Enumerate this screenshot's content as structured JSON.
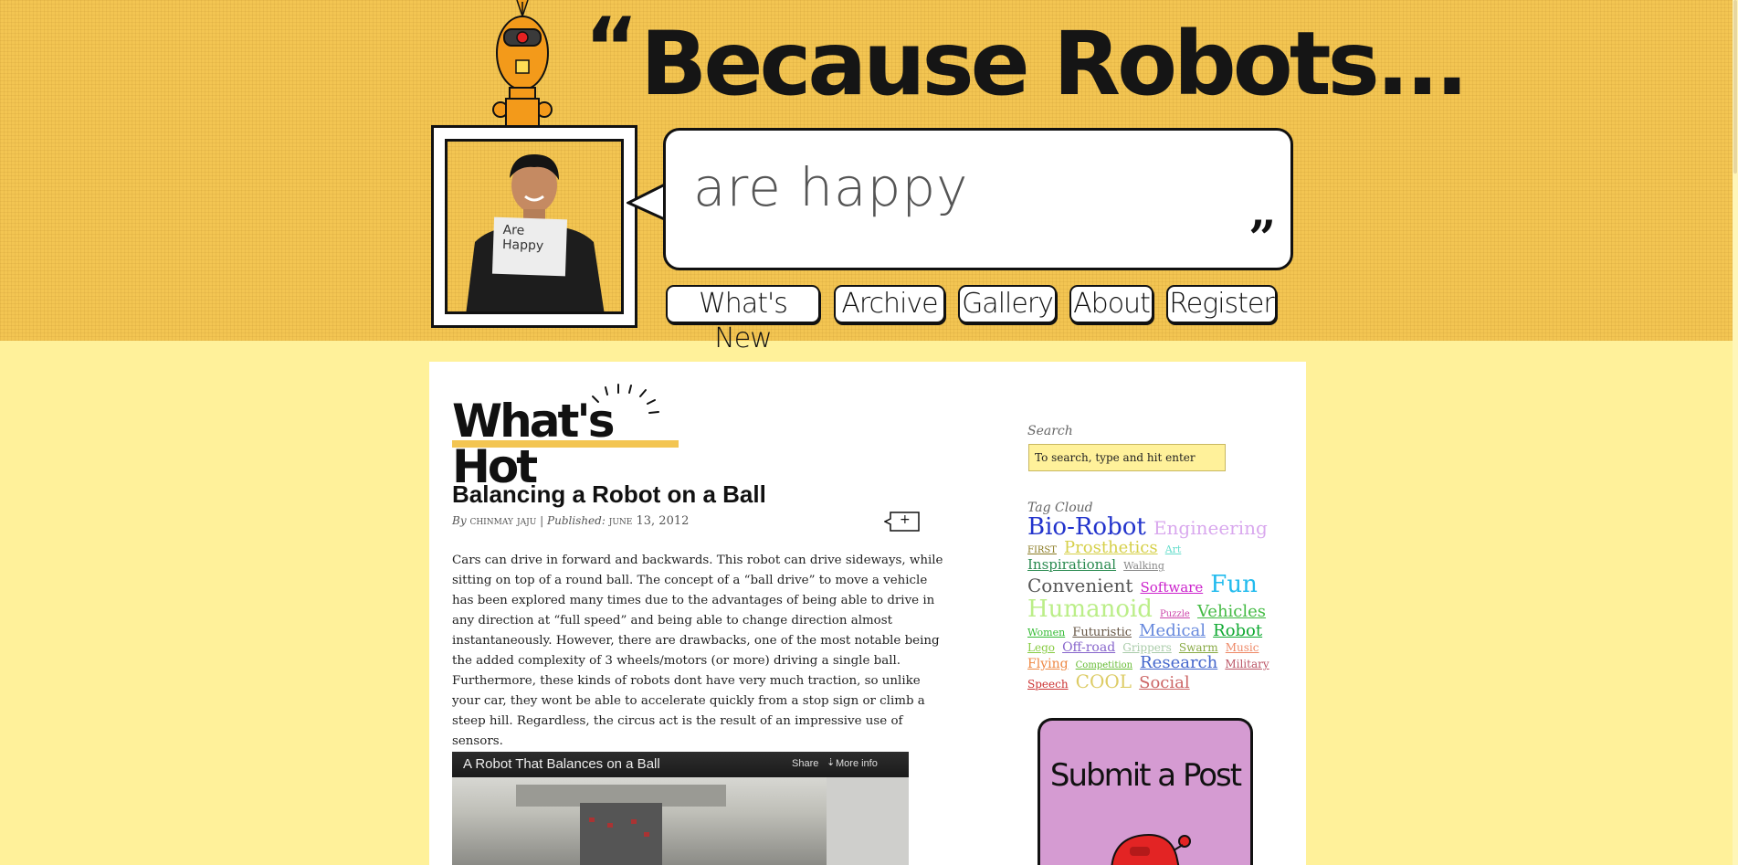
{
  "header": {
    "title": "Because Robots...",
    "open_quote": "“",
    "tagline": "are happy",
    "close_quote": "”",
    "sign_text": "Are Happy"
  },
  "nav": {
    "items": [
      {
        "label": "What's New"
      },
      {
        "label": "Archive"
      },
      {
        "label": "Gallery"
      },
      {
        "label": "About"
      },
      {
        "label": "Register"
      }
    ]
  },
  "main": {
    "section_title": "What's Hot",
    "post": {
      "title": "Balancing a Robot on a Ball",
      "by": "By",
      "author": "CHINMAY JAJU",
      "published_label": "| Published:",
      "date": "JUNE 13, 2012",
      "share_icon_label": "+",
      "body": "Cars can drive in forward and backwards. This robot can drive sideways, while sitting on top of a round ball. The concept of a “ball drive” to move a vehicle has been explored many times due to the advantages of being able to drive in any direction at “full speed” and being able to change direction almost instantaneously. However, there are drawbacks, one of the most notable being the added complexity of 3 wheels/motors (or more) driving a single ball. Furthermore, these kinds of robots dont have very much traction, so unlike your car, they wont be able to accelerate quickly from a stop sign or climb a steep hill. Regardless, the circus act is the result of an impressive use of sensors."
    },
    "video": {
      "title": "A Robot That Balances on a Ball",
      "share": "Share",
      "more_info": "More info"
    }
  },
  "sidebar": {
    "search_label": "Search",
    "search_placeholder": "To search, type and hit enter",
    "tag_cloud_label": "Tag Cloud",
    "tags": [
      {
        "label": "Bio-Robot",
        "color": "#2233cc",
        "size": 26
      },
      {
        "label": "Engineering",
        "color": "#d9a8ee",
        "size": 20
      },
      {
        "label": "FIRST",
        "color": "#8a7a22",
        "size": 10
      },
      {
        "label": "Prosthetics",
        "color": "#d6d04a",
        "size": 18
      },
      {
        "label": "Art",
        "color": "#66ddcc",
        "size": 11
      },
      {
        "label": "Inspirational",
        "color": "#2a8a50",
        "size": 15
      },
      {
        "label": "Walking",
        "color": "#888888",
        "size": 11
      },
      {
        "label": "Convenient",
        "color": "#555555",
        "size": 20
      },
      {
        "label": "Software",
        "color": "#cc22cc",
        "size": 15
      },
      {
        "label": "Fun",
        "color": "#22bbee",
        "size": 26
      },
      {
        "label": "Humanoid",
        "color": "#bbee88",
        "size": 26
      },
      {
        "label": "Puzzle",
        "color": "#cc44aa",
        "size": 10
      },
      {
        "label": "Vehicles",
        "color": "#44bb44",
        "size": 18
      },
      {
        "label": "Women",
        "color": "#33bb33",
        "size": 11
      },
      {
        "label": "Futuristic",
        "color": "#665544",
        "size": 13
      },
      {
        "label": "Medical",
        "color": "#6688dd",
        "size": 18
      },
      {
        "label": "Robot",
        "color": "#11aa33",
        "size": 18
      },
      {
        "label": "Lego",
        "color": "#88cc44",
        "size": 12
      },
      {
        "label": "Off-road",
        "color": "#8866cc",
        "size": 14
      },
      {
        "label": "Grippers",
        "color": "#aaccaa",
        "size": 12
      },
      {
        "label": "Swarm",
        "color": "#88aa44",
        "size": 12
      },
      {
        "label": "Music",
        "color": "#ee8866",
        "size": 12
      },
      {
        "label": "Flying",
        "color": "#ee8844",
        "size": 14
      },
      {
        "label": "Competition",
        "color": "#66bb33",
        "size": 10
      },
      {
        "label": "Research",
        "color": "#4466cc",
        "size": 18
      },
      {
        "label": "Military",
        "color": "#bb5566",
        "size": 12
      },
      {
        "label": "Speech",
        "color": "#cc3333",
        "size": 12
      },
      {
        "label": "COOL",
        "color": "#ddcc66",
        "size": 20
      },
      {
        "label": "Social",
        "color": "#cc6666",
        "size": 18
      }
    ],
    "submit_label": "Submit a Post"
  }
}
